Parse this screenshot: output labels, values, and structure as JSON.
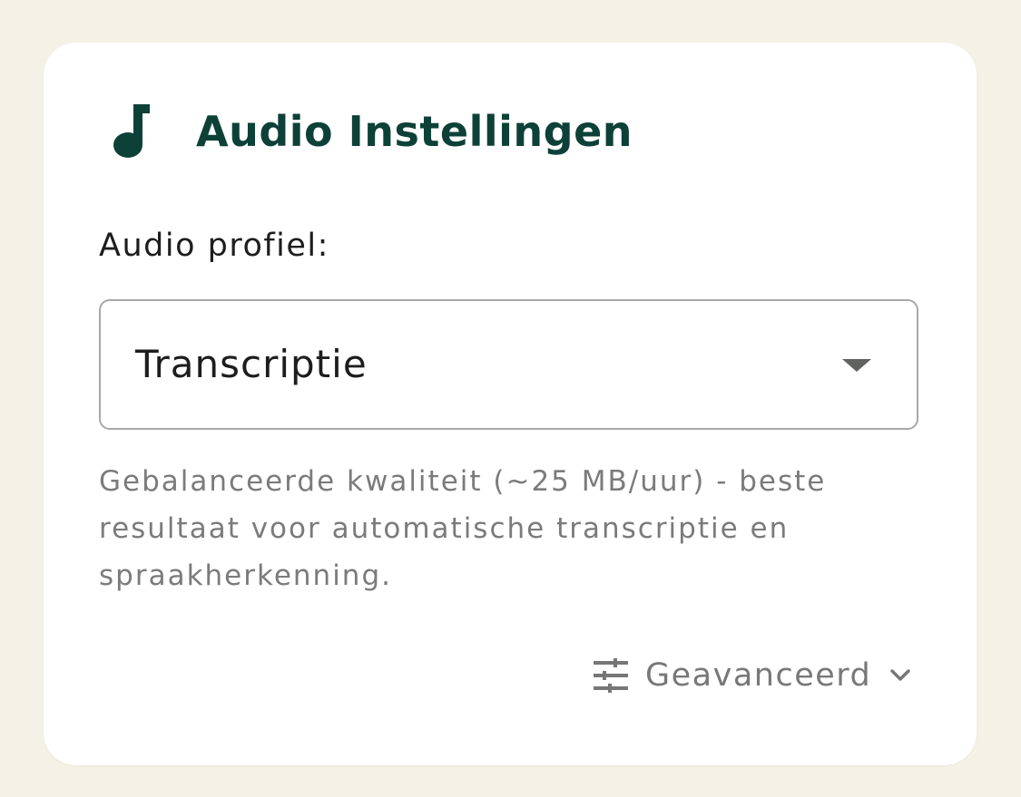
{
  "card": {
    "title": "Audio Instellingen",
    "title_icon": "music-note-icon",
    "audio_profile": {
      "label": "Audio profiel:",
      "selected_value": "Transcriptie",
      "caret_icon": "caret-down-icon",
      "description": "Gebalanceerde kwaliteit (~25 MB/uur) - beste resultaat voor automatische transcriptie en spraakherkenning."
    },
    "advanced": {
      "label": "Geavanceerd",
      "icon": "tune-icon",
      "expand_icon": "chevron-down-icon"
    }
  },
  "colors": {
    "page_background": "#f4f1e6",
    "card_background": "#ffffff",
    "title_color": "#0d4138",
    "body_text": "#1d1d1d",
    "muted_text": "#7b7b7b",
    "border": "#a8a8a8"
  }
}
